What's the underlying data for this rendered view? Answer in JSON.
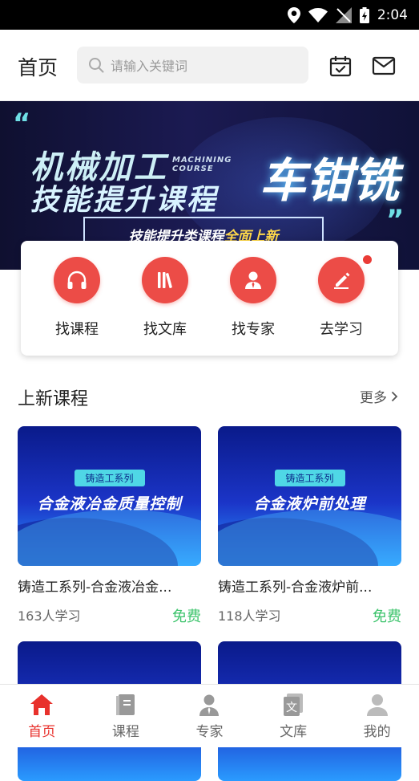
{
  "status_bar": {
    "time": "2:04"
  },
  "header": {
    "title": "首页",
    "search_placeholder": "请输入关键词"
  },
  "banner": {
    "line1": "机械加工",
    "line2": "技能提升课程",
    "english": "MACHINING COURSE",
    "big_text": "车钳铣",
    "sub_before": "技能提升类课程",
    "sub_highlight": "全面上新"
  },
  "quick_actions": [
    {
      "label": "找课程",
      "icon": "headphones-icon"
    },
    {
      "label": "找文库",
      "icon": "library-icon"
    },
    {
      "label": "找专家",
      "icon": "expert-icon"
    },
    {
      "label": "去学习",
      "icon": "pencil-icon"
    }
  ],
  "section": {
    "title": "上新课程",
    "more": "更多"
  },
  "courses": [
    {
      "tag": "铸造工系列",
      "thumb_title": "合金液冶金质量控制",
      "name": "铸造工系列-合金液冶金...",
      "count": "163人学习",
      "price": "免费"
    },
    {
      "tag": "铸造工系列",
      "thumb_title": "合金液炉前处理",
      "name": "铸造工系列-合金液炉前...",
      "count": "118人学习",
      "price": "免费"
    }
  ],
  "tabbar": [
    {
      "label": "首页",
      "icon": "home-icon",
      "active": true
    },
    {
      "label": "课程",
      "icon": "course-icon",
      "active": false
    },
    {
      "label": "专家",
      "icon": "expert-icon",
      "active": false
    },
    {
      "label": "文库",
      "icon": "library-icon",
      "active": false
    },
    {
      "label": "我的",
      "icon": "profile-icon",
      "active": false
    }
  ],
  "colors": {
    "accent": "#e8312c",
    "free": "#3ec46d"
  }
}
